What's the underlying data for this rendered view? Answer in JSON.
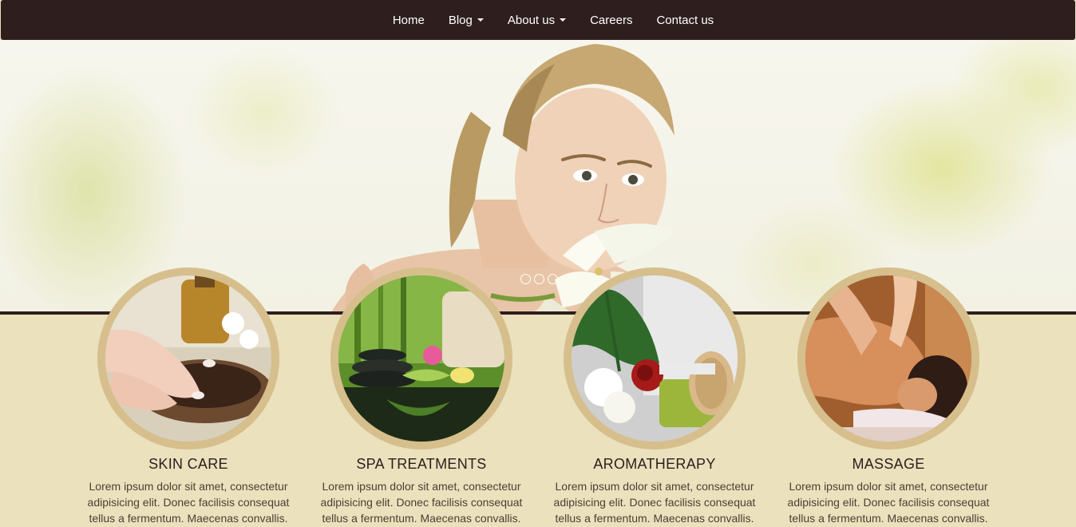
{
  "nav": {
    "items": [
      {
        "label": "Home",
        "dropdown": false
      },
      {
        "label": "Blog",
        "dropdown": true
      },
      {
        "label": "About us",
        "dropdown": true
      },
      {
        "label": "Careers",
        "dropdown": false
      },
      {
        "label": "Contact us",
        "dropdown": false
      }
    ]
  },
  "hero": {
    "slide_count": 3,
    "active_slide": 1
  },
  "features": [
    {
      "title": "SKIN CARE",
      "text": "Lorem ipsum dolor sit amet, consectetur adipisicing elit. Donec facilisis consequat tellus a fermentum. Maecenas convallis."
    },
    {
      "title": "SPA TREATMENTS",
      "text": "Lorem ipsum dolor sit amet, consectetur adipisicing elit. Donec facilisis consequat tellus a fermentum. Maecenas convallis."
    },
    {
      "title": "AROMATHERAPY",
      "text": "Lorem ipsum dolor sit amet, consectetur adipisicing elit. Donec facilisis consequat tellus a fermentum. Maecenas convallis."
    },
    {
      "title": "MASSAGE",
      "text": "Lorem ipsum dolor sit amet, consectetur adipisicing elit. Donec facilisis consequat tellus a fermentum. Maecenas convallis."
    }
  ],
  "colors": {
    "nav_bg": "#2e1f1e",
    "page_bg": "#ebe1bd",
    "circle_ring": "#d6bf8c",
    "title_text": "#2b1f1c"
  }
}
